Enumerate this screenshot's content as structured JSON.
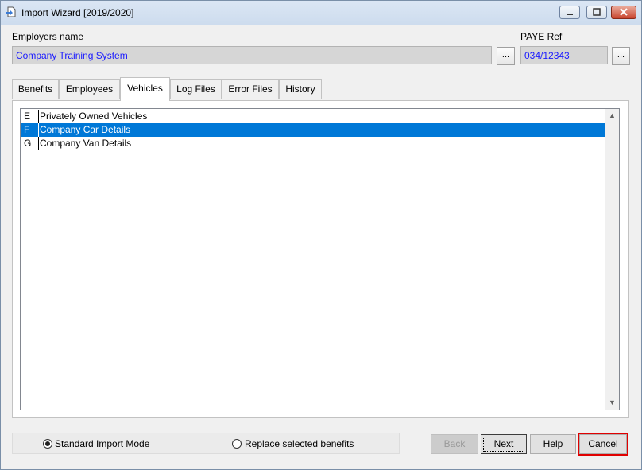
{
  "window": {
    "title": "Import Wizard [2019/2020]"
  },
  "employer": {
    "label": "Employers name",
    "value": "Company Training System",
    "browse_label": "..."
  },
  "paye": {
    "label": "PAYE Ref",
    "value": "034/12343",
    "browse_label": "..."
  },
  "tabs": [
    {
      "label": "Benefits",
      "active": false
    },
    {
      "label": "Employees",
      "active": false
    },
    {
      "label": "Vehicles",
      "active": true
    },
    {
      "label": "Log Files",
      "active": false
    },
    {
      "label": "Error Files",
      "active": false
    },
    {
      "label": "History",
      "active": false
    }
  ],
  "vehicles": [
    {
      "code": "E",
      "description": "Privately Owned Vehicles",
      "selected": false
    },
    {
      "code": "F",
      "description": "Company Car Details",
      "selected": true
    },
    {
      "code": "G",
      "description": "Company Van Details",
      "selected": false
    }
  ],
  "import_mode": {
    "standard_label": "Standard Import Mode",
    "replace_label": "Replace selected benefits",
    "selected": "standard"
  },
  "buttons": {
    "back": "Back",
    "next": "Next",
    "help": "Help",
    "cancel": "Cancel"
  },
  "colors": {
    "selection": "#0078d7",
    "field_text": "#1a1aff",
    "highlight": "#e00000"
  }
}
